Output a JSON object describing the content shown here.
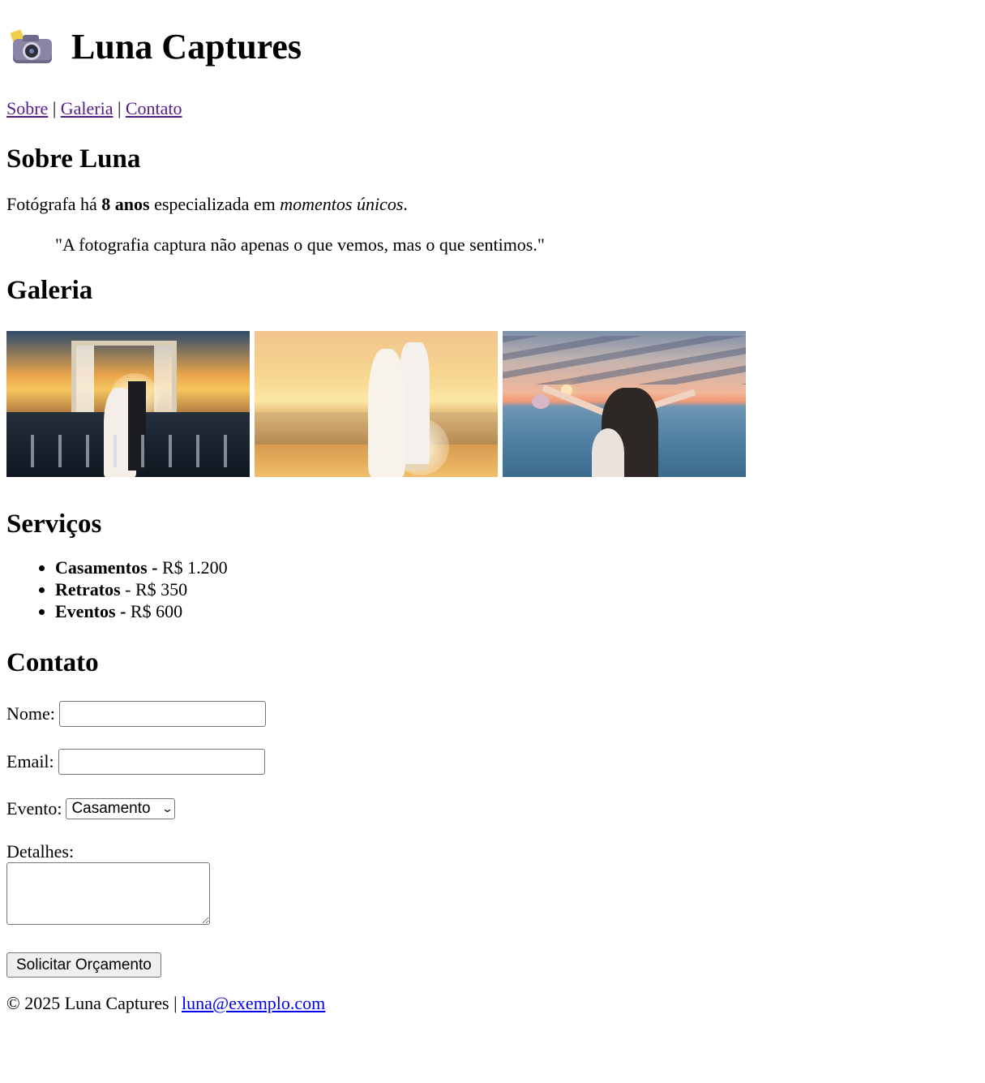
{
  "header": {
    "title": "Luna Captures",
    "icon": "camera-icon"
  },
  "nav": {
    "items": [
      "Sobre",
      "Galeria",
      "Contato"
    ],
    "separator": "|"
  },
  "sobre": {
    "heading": "Sobre Luna",
    "bio_prefix": "Fotógrafa há",
    "bio_bold": "8 anos",
    "bio_middle": "especializada em",
    "bio_italic": "momentos únicos",
    "bio_suffix": ".",
    "quote": "\"A fotografia captura não apenas o que vemos, mas o que sentimos.\""
  },
  "galeria": {
    "heading": "Galeria",
    "photos": [
      "wedding-ceremony-sunset-photo",
      "beach-couple-kiss-photo",
      "couple-sea-sunset-photo"
    ]
  },
  "servicos": {
    "heading": "Serviços",
    "items": [
      {
        "name": "Casamentos",
        "price": "R$ 1.200"
      },
      {
        "name": "Retratos",
        "price": "R$ 350"
      },
      {
        "name": "Eventos",
        "price": "R$ 600"
      }
    ],
    "separator": " - "
  },
  "contato": {
    "heading": "Contato",
    "nome_label": "Nome:",
    "nome_value": "",
    "email_label": "Email:",
    "email_value": "",
    "evento_label": "Evento:",
    "evento_selected": "Casamento",
    "detalhes_label": "Detalhes:",
    "detalhes_value": "",
    "submit_label": "Solicitar Orçamento"
  },
  "footer": {
    "text": "© 2025 Luna Captures |",
    "email": "luna@exemplo.com"
  }
}
